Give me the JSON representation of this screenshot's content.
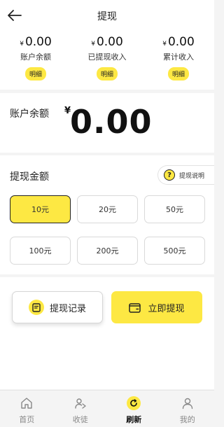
{
  "header": {
    "title": "提现"
  },
  "stats": [
    {
      "currency": "¥",
      "value": "0.00",
      "label": "账户余额",
      "button": "明细"
    },
    {
      "currency": "¥",
      "value": "0.00",
      "label": "已提现收入",
      "button": "明细"
    },
    {
      "currency": "¥",
      "value": "0.00",
      "label": "累计收入",
      "button": "明细"
    }
  ],
  "balance": {
    "label": "账户余额",
    "currency": "¥",
    "value": "0.00"
  },
  "amount": {
    "title": "提现金额",
    "help_label": "提现说明",
    "help_icon_glyph": "?",
    "options": [
      "10元",
      "20元",
      "50元",
      "100元",
      "200元",
      "500元"
    ],
    "selected": "10元"
  },
  "actions": {
    "record_label": "提现记录",
    "withdraw_label": "立即提现"
  },
  "tabbar": {
    "items": [
      {
        "label": "首页",
        "icon": "home-icon"
      },
      {
        "label": "收徒",
        "icon": "share-icon"
      },
      {
        "label": "刷新",
        "icon": "refresh-icon",
        "active": true
      },
      {
        "label": "我的",
        "icon": "user-icon"
      }
    ]
  },
  "colors": {
    "accent": "#fde843",
    "text": "#222222",
    "background": "#f4f4f4"
  }
}
